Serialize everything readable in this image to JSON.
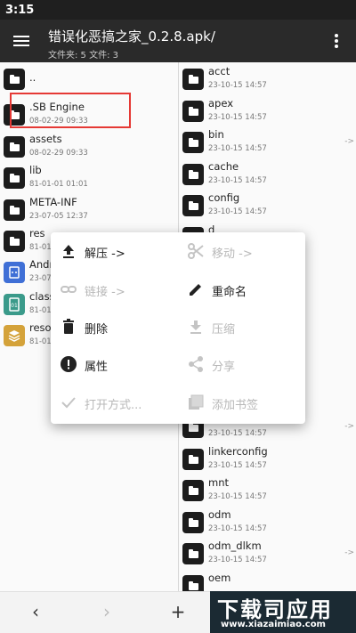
{
  "status_bar": {
    "time": "3:15"
  },
  "app_bar": {
    "title": "错误化恶搞之家_0.2.8.apk/",
    "subtitle": "文件夹: 5  文件: 3"
  },
  "left_pane": {
    "items": [
      {
        "name": "..",
        "date": "",
        "type": "folder"
      },
      {
        "name": ".SB Engine",
        "date": "08-02-29 09:33",
        "type": "folder"
      },
      {
        "name": "assets",
        "date": "08-02-29 09:33",
        "type": "folder"
      },
      {
        "name": "lib",
        "date": "81-01-01 01:01",
        "type": "folder"
      },
      {
        "name": "META-INF",
        "date": "23-07-05 12:37",
        "type": "folder"
      },
      {
        "name": "res",
        "date": "81-01-",
        "type": "folder"
      },
      {
        "name": "Andr",
        "date": "23-07-",
        "type": "android"
      },
      {
        "name": "class",
        "date": "81-01-",
        "type": "dex"
      },
      {
        "name": "resou",
        "date": "81-01-",
        "type": "archive"
      }
    ]
  },
  "right_pane": {
    "items": [
      {
        "name": "acct",
        "date": "23-10-15 14:57",
        "arrow": ""
      },
      {
        "name": "apex",
        "date": "23-10-15 14:57",
        "arrow": ""
      },
      {
        "name": "bin",
        "date": "23-10-15 14:57",
        "arrow": "->"
      },
      {
        "name": "cache",
        "date": "23-10-15 14:57",
        "arrow": ""
      },
      {
        "name": "config",
        "date": "23-10-15 14:57",
        "arrow": ""
      },
      {
        "name": "d",
        "date": "",
        "arrow": ""
      },
      {
        "name": "lib",
        "date": "23-10-15 14:57",
        "arrow": "->"
      },
      {
        "name": "linkerconfig",
        "date": "23-10-15 14:57",
        "arrow": ""
      },
      {
        "name": "mnt",
        "date": "23-10-15 14:57",
        "arrow": ""
      },
      {
        "name": "odm",
        "date": "23-10-15 14:57",
        "arrow": ""
      },
      {
        "name": "odm_dlkm",
        "date": "23-10-15 14:57",
        "arrow": "->"
      },
      {
        "name": "oem",
        "date": "",
        "arrow": ""
      }
    ]
  },
  "context_menu": {
    "extract": "解压 ->",
    "move": "移动 ->",
    "link": "链接 ->",
    "rename": "重命名",
    "delete": "删除",
    "compress": "压缩",
    "properties": "属性",
    "share": "分享",
    "open_with": "打开方式...",
    "add_bookmark": "添加书签"
  },
  "bottom_bar": {
    "back": "‹",
    "forward": "›",
    "add": "+"
  },
  "watermark": {
    "main": "下载司应用",
    "url": "www.xiazaimiao.com"
  },
  "colors": {
    "app_bar": "#2a2a2a",
    "folder_icon": "#1c1c1c",
    "highlight": "#e53935",
    "menu_bg": "#ffffff"
  }
}
